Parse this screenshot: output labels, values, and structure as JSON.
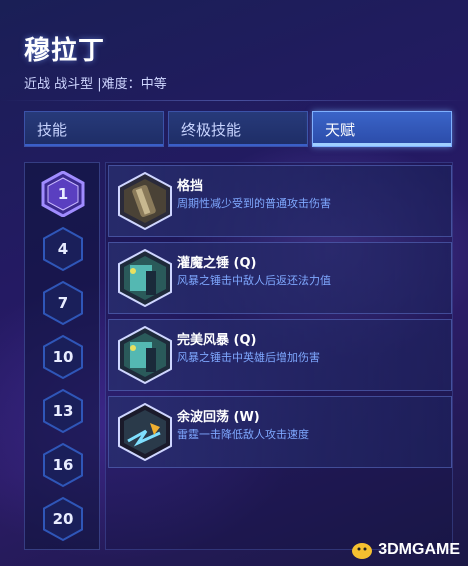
{
  "hero": {
    "name": "穆拉丁",
    "role": "近战 战斗型",
    "separator": "|",
    "difficulty_label": "难度：",
    "difficulty_value": "中等"
  },
  "tabs": [
    {
      "label": "技能",
      "active": false
    },
    {
      "label": "终极技能",
      "active": false
    },
    {
      "label": "天赋",
      "active": true
    }
  ],
  "tiers": [
    {
      "level": "1",
      "selected": true
    },
    {
      "level": "4",
      "selected": false
    },
    {
      "level": "7",
      "selected": false
    },
    {
      "level": "10",
      "selected": false
    },
    {
      "level": "13",
      "selected": false
    },
    {
      "level": "16",
      "selected": false
    },
    {
      "level": "20",
      "selected": false
    }
  ],
  "talents": [
    {
      "name": "格挡",
      "description": "周期性减少受到的普通攻击伤害",
      "icon": "shield-icon"
    },
    {
      "name": "灌魔之锤 (Q)",
      "description": "风暴之锤击中敌人后返还法力值",
      "icon": "hammer-icon"
    },
    {
      "name": "完美风暴 (Q)",
      "description": "风暴之锤击中英雄后增加伤害",
      "icon": "hammer-icon"
    },
    {
      "name": "余波回荡 (W)",
      "description": "雷霆一击降低敌人攻击速度",
      "icon": "thunderclap-icon"
    }
  ],
  "watermark": {
    "text": "3DMGAME"
  },
  "colors": {
    "accent": "#7fb0ff",
    "description": "#7fa8ff",
    "tier_selected": "#8a6cff",
    "tier_normal": "#2f56b8"
  }
}
